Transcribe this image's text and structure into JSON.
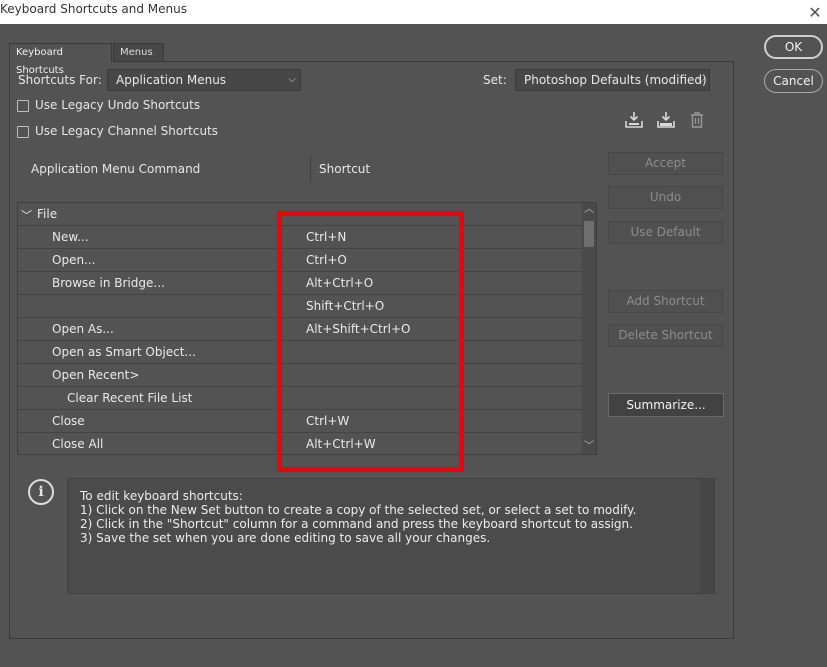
{
  "window": {
    "title": "Keyboard Shortcuts and Menus"
  },
  "tabs": [
    {
      "label": "Keyboard Shortcuts"
    },
    {
      "label": "Menus"
    }
  ],
  "shortcuts_for": {
    "label": "Shortcuts For:",
    "value": "Application Menus"
  },
  "set": {
    "label": "Set:",
    "value": "Photoshop Defaults (modified)"
  },
  "options": [
    {
      "label": "Use Legacy Undo Shortcuts"
    },
    {
      "label": "Use Legacy Channel Shortcuts"
    }
  ],
  "columns": {
    "command": "Application Menu Command",
    "shortcut": "Shortcut"
  },
  "group": {
    "label": "File"
  },
  "rows": [
    {
      "command": "New...",
      "shortcut": "Ctrl+N"
    },
    {
      "command": "Open...",
      "shortcut": "Ctrl+O"
    },
    {
      "command": "Browse in Bridge...",
      "shortcut": "Alt+Ctrl+O"
    },
    {
      "command": "",
      "shortcut": "Shift+Ctrl+O"
    },
    {
      "command": "Open As...",
      "shortcut": "Alt+Shift+Ctrl+O"
    },
    {
      "command": "Open as Smart Object...",
      "shortcut": ""
    },
    {
      "command": "Open Recent>",
      "shortcut": ""
    },
    {
      "command": "Clear Recent File List",
      "shortcut": ""
    },
    {
      "command": "Close",
      "shortcut": "Ctrl+W"
    },
    {
      "command": "Close All",
      "shortcut": "Alt+Ctrl+W"
    }
  ],
  "side_buttons": {
    "accept": "Accept",
    "undo": "Undo",
    "use_default": "Use Default",
    "add_shortcut": "Add Shortcut",
    "delete_shortcut": "Delete Shortcut",
    "summarize": "Summarize..."
  },
  "dialog_buttons": {
    "ok": "OK",
    "cancel": "Cancel"
  },
  "info": {
    "lines": [
      "To edit keyboard shortcuts:",
      "1) Click on the New Set button to create a copy of the selected set, or select a set to modify.",
      "2) Click in the \"Shortcut\" column for a command and press the keyboard shortcut to assign.",
      "3) Save the set when you are done editing to save all your changes."
    ]
  },
  "colors": {
    "highlight": "#e8060a",
    "background": "#535353"
  }
}
